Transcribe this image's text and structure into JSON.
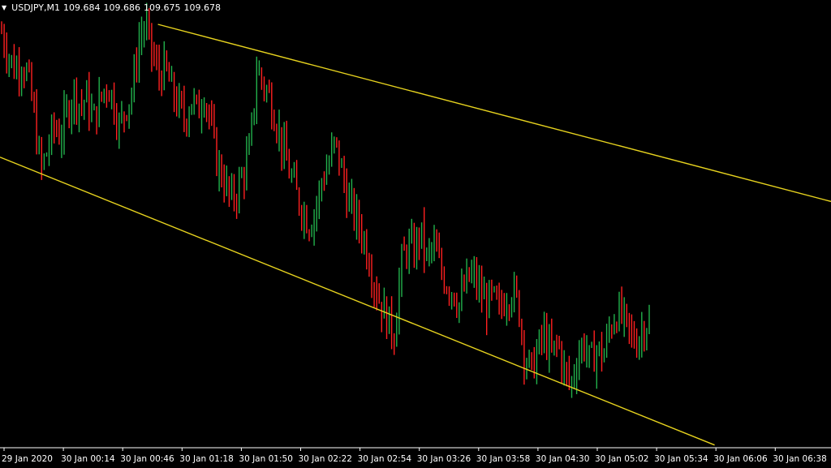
{
  "header": {
    "collapse_arrow": "▼",
    "symbol_timeframe": "USDJPY,M1",
    "open": "109.684",
    "high": "109.686",
    "low": "109.675",
    "close": "109.678"
  },
  "colors": {
    "background": "#000000",
    "axis": "#ffffff",
    "bull_candle": "#22b14c",
    "bear_candle": "#ff2020",
    "channel_lines": "#e6d21e",
    "axis_labels": "#ffffff"
  },
  "chart_data": {
    "type": "bar",
    "subtype": "ohlc-bars",
    "symbol": "USDJPY",
    "timeframe": "M1",
    "last_bar": {
      "open": 109.684,
      "high": 109.686,
      "low": 109.675,
      "close": 109.678
    },
    "x_tick_labels": [
      "29 Jan 2020",
      "30 Jan 00:14",
      "30 Jan 00:46",
      "30 Jan 01:18",
      "30 Jan 01:50",
      "30 Jan 02:22",
      "30 Jan 02:54",
      "30 Jan 03:26",
      "30 Jan 03:58",
      "30 Jan 04:30",
      "30 Jan 05:02",
      "30 Jan 05:34",
      "30 Jan 06:06",
      "30 Jan 06:38"
    ],
    "price_path_relative": [
      0.98,
      0.92,
      0.88,
      0.9,
      0.86,
      0.75,
      0.6,
      0.66,
      0.72,
      0.7,
      0.76,
      0.82,
      0.78,
      0.8,
      0.74,
      0.79,
      0.84,
      0.8,
      0.72,
      0.78,
      0.82,
      0.96,
      1.0,
      0.92,
      0.86,
      0.88,
      0.82,
      0.78,
      0.74,
      0.8,
      0.76,
      0.82,
      0.72,
      0.62,
      0.58,
      0.52,
      0.55,
      0.6,
      0.66,
      0.88,
      0.84,
      0.8,
      0.74,
      0.66,
      0.6,
      0.54,
      0.5,
      0.46,
      0.5,
      0.58,
      0.62,
      0.68,
      0.6,
      0.52,
      0.48,
      0.44,
      0.38,
      0.3,
      0.24,
      0.2,
      0.16,
      0.34,
      0.4,
      0.38,
      0.44,
      0.36,
      0.4,
      0.34,
      0.3,
      0.28,
      0.24,
      0.3,
      0.32,
      0.28,
      0.24,
      0.26,
      0.22,
      0.26,
      0.28,
      0.24,
      0.1,
      0.06,
      0.12,
      0.16,
      0.1,
      0.14,
      0.06,
      0.02,
      0.1,
      0.14,
      0.08,
      0.12,
      0.1,
      0.18,
      0.22,
      0.2,
      0.16,
      0.14,
      0.18,
      0.2
    ],
    "channel": {
      "upper": [
        {
          "x_rel": 0.19,
          "y_rel": 1.0
        },
        {
          "x_rel": 1.0,
          "y_rel": 0.52
        }
      ],
      "lower": [
        {
          "x_rel": 0.0,
          "y_rel": 0.64
        },
        {
          "x_rel": 0.86,
          "y_rel": -0.14
        }
      ]
    },
    "grid": false,
    "legend": "none"
  }
}
